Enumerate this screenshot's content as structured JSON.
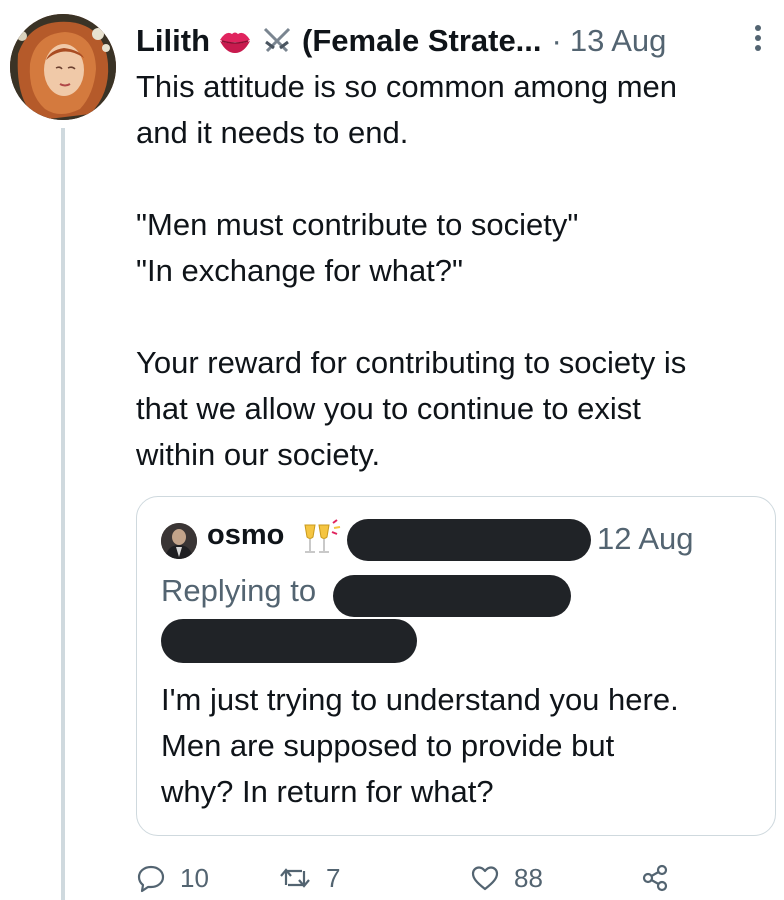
{
  "tweet": {
    "author_name": "Lilith",
    "author_name_extra": "(Female Strate...",
    "separator": "·",
    "date": "13 Aug",
    "emojis": [
      "lips-icon",
      "crossed-swords-icon"
    ],
    "body": [
      "This attitude is so common among men",
      "and it needs to end.",
      "",
      "\"Men must contribute to society\"",
      "\"In exchange for what?\"",
      "",
      "Your reward for contributing to society is",
      "that we allow you to continue to exist",
      "within our society."
    ]
  },
  "quoted_tweet": {
    "author_name": "osmo",
    "emoji": "clinking-glasses-icon",
    "date": "12 Aug",
    "replying_to_label": "Replying to",
    "body": [
      "I'm just trying to understand you here.",
      "Men are supposed to provide but",
      "why? In return for what?"
    ]
  },
  "actions": {
    "reply_count": "10",
    "retweet_count": "7",
    "like_count": "88"
  },
  "colors": {
    "text": "#0f1419",
    "muted": "#536471",
    "border": "#cfd9de",
    "redaction": "#202327",
    "lips": "#e0245e"
  }
}
